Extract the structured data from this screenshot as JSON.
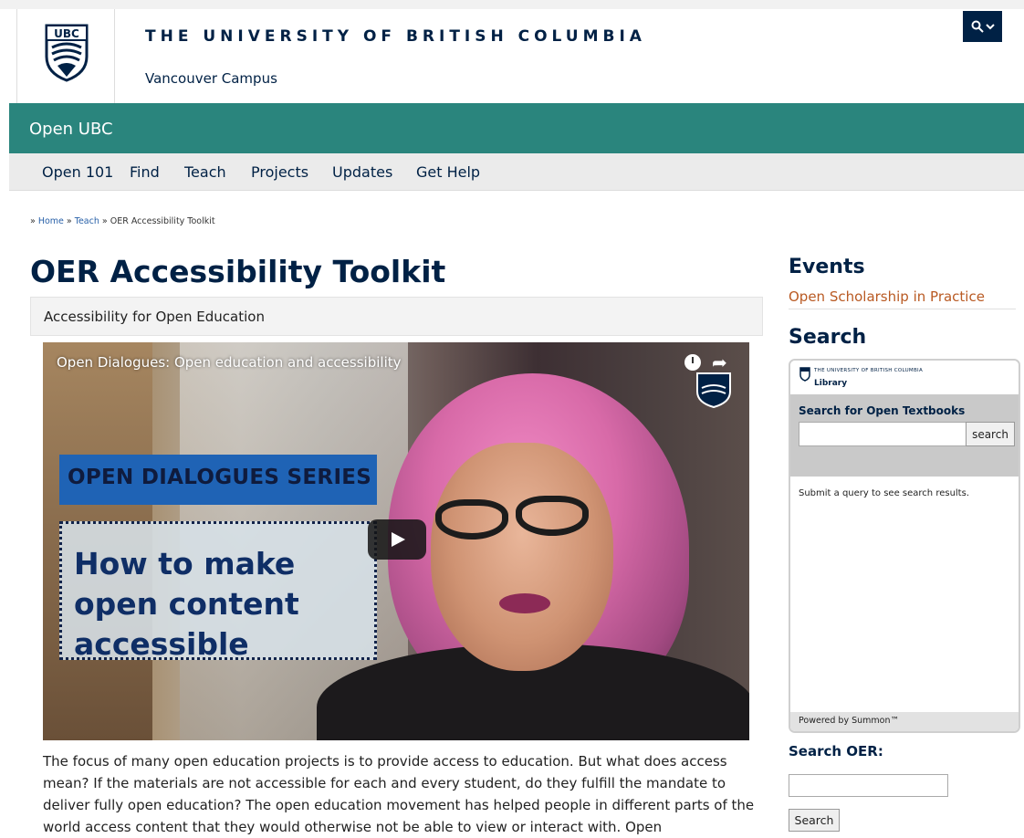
{
  "header": {
    "university": "THE UNIVERSITY OF BRITISH COLUMBIA",
    "campus": "Vancouver Campus",
    "crest_text": "UBC",
    "search_toggle_icon": "search-icon"
  },
  "site": {
    "name": "Open UBC"
  },
  "nav": {
    "items": [
      {
        "label": "Open 101"
      },
      {
        "label": "Find"
      },
      {
        "label": "Teach"
      },
      {
        "label": "Projects"
      },
      {
        "label": "Updates"
      },
      {
        "label": "Get Help"
      }
    ]
  },
  "breadcrumb": {
    "prefix": "» ",
    "home": "Home",
    "sep": " » ",
    "teach": "Teach",
    "current": "OER Accessibility Toolkit"
  },
  "main": {
    "title": "OER Accessibility Toolkit",
    "section_label": "Accessibility for Open Education",
    "video": {
      "title": "Open Dialogues: Open education and accessibility",
      "series": "OPEN DIALOGUES SERIES",
      "headline": "How to make open content accessible"
    },
    "body": "The focus of many open education projects is to provide access to education. But what does access mean? If the materials are not accessible for each and every student, do they fulfill the mandate to deliver fully open education? The open education movement has helped people in different parts of the world access content that they would otherwise not be able to view or interact with. Open"
  },
  "sidebar": {
    "events_heading": "Events",
    "event_link": "Open Scholarship in Practice",
    "search_heading": "Search",
    "library": {
      "univ": "THE UNIVERSITY OF BRITISH COLUMBIA",
      "name": "Library",
      "search_label": "Search for Open Textbooks",
      "search_button": "search",
      "result_text": "Submit a query to see search results.",
      "powered_by": "Powered by Summon™"
    },
    "oer_label": "Search OER:",
    "oer_button": "Search"
  },
  "colors": {
    "navy": "#002145",
    "teal": "#2a857d",
    "link": "#2860a8",
    "event": "#b95a23"
  }
}
